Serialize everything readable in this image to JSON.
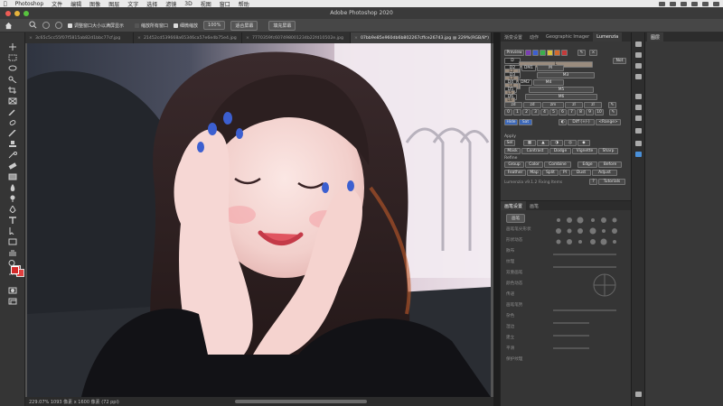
{
  "menubar": {
    "app": "Photoshop",
    "items": [
      "文件",
      "编辑",
      "图像",
      "图层",
      "文字",
      "选择",
      "滤镜",
      "3D",
      "视图",
      "窗口",
      "帮助"
    ]
  },
  "window": {
    "title": "Adobe Photoshop 2020"
  },
  "options": {
    "check1": "调整窗口大小以满屏显示",
    "check2": "缩放所有窗口",
    "check3": "细微缩放",
    "zoom_pct": "100%",
    "fit_screen": "适合屏幕",
    "fill_screen": "填充屏幕"
  },
  "tabs": [
    {
      "label": "3c65c5cc55f07f5815ab82d1bbc77cf.jpg",
      "active": false
    },
    {
      "label": "21452cd539668a65346ca57e6e4b75e4.jpg",
      "active": false
    },
    {
      "label": "7770359fc607498001234b22fd10502e.jpg",
      "active": false
    },
    {
      "label": "07bb9e85e960db6b802267cffce26743.jpg @ 229%(RGB/8*)",
      "active": true
    }
  ],
  "status": {
    "text": "229.07%   1093 像素 x 1600 像素 (72 ppi)"
  },
  "panel_tabs": [
    "渐变设置",
    "动作",
    "Geographic Imager",
    "Lumenzia"
  ],
  "panel_active_tab": "Lumenzia",
  "lumenzia": {
    "preview": "Preview",
    "not": "Not",
    "rows": [
      [
        "D",
        "L"
      ],
      [
        "D2",
        "DM1",
        "M",
        "LM1",
        "L2"
      ],
      [
        "D3",
        "M3",
        "L3"
      ],
      [
        "D4",
        "DM2",
        "M4",
        "LM2",
        "L4"
      ],
      [
        "D5",
        "M5",
        "L5"
      ],
      [
        "D6",
        "M6",
        "L6"
      ]
    ],
    "zone_row": [
      "zd",
      "zd",
      "zm",
      "zl",
      "zl"
    ],
    "numbers": [
      "0",
      "1",
      "2",
      "3",
      "4",
      "5",
      "6",
      "7",
      "8",
      "9",
      "10"
    ],
    "misc_row": [
      "Diff (+/-)",
      "<Range>"
    ],
    "hide_row": [
      "Hide",
      "Sat"
    ],
    "apply_label": "Apply",
    "apply_row": [
      "Mask",
      "Contrast",
      "Dodge",
      "Vignette",
      "Sharp"
    ],
    "refine_label": "Refine",
    "refine_row": [
      "Group",
      "Color",
      "Combine",
      "Edge",
      "Before"
    ],
    "refine_row2": [
      "Feather",
      "Map",
      "Split",
      "PI",
      "Dust",
      "Adjust"
    ],
    "footer": "Lumenzia v9.1.2 Fixing Items",
    "tutorials": "Tutorials"
  },
  "lower_panel": {
    "tabs": [
      "画笔设置",
      "画笔"
    ],
    "header": "画笔",
    "items": [
      "画笔笔尖形状",
      "形状动态",
      "散布",
      "纹理",
      "双重画笔",
      "颜色动态",
      "传递",
      "画笔笔势",
      "杂色",
      "湿边",
      "建立",
      "平滑",
      "保护纹理"
    ]
  },
  "far_panel": {
    "tab": "图层"
  },
  "colors": {
    "foreground": "#d42a2a",
    "background": "#e04040",
    "accent": "#4a8fd8"
  }
}
